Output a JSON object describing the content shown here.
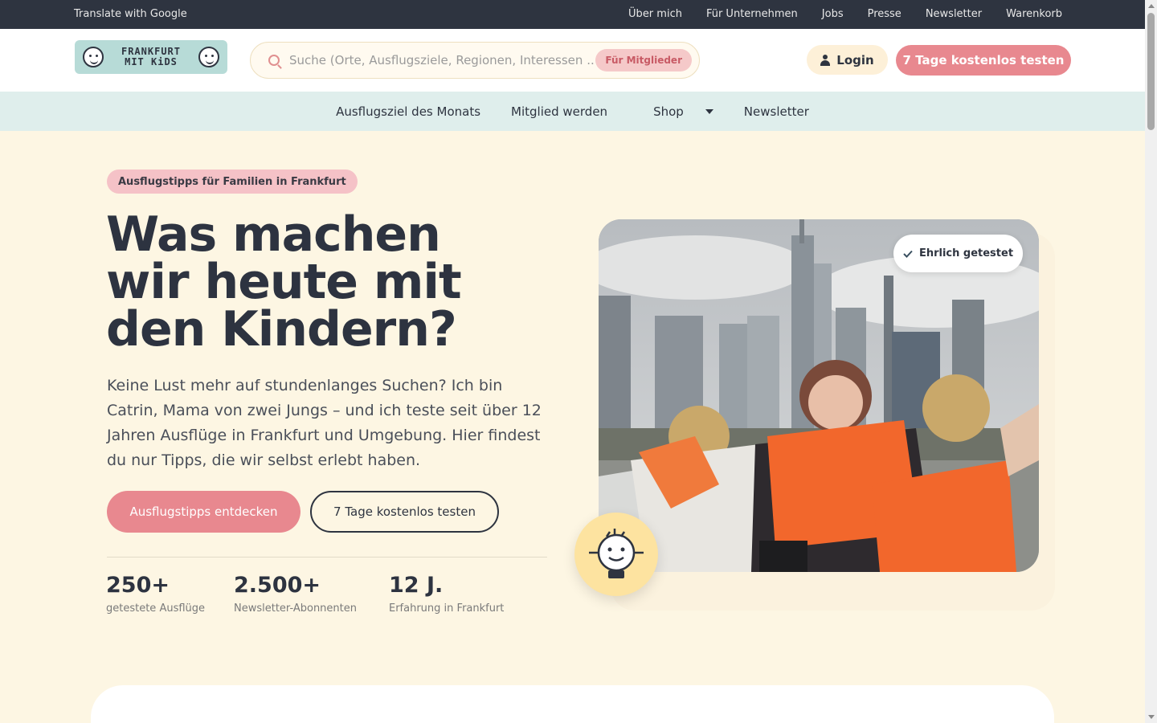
{
  "topbar": {
    "translate": "Translate with Google",
    "links": [
      "Über mich",
      "Für Unternehmen",
      "Jobs",
      "Presse",
      "Newsletter",
      "Warenkorb"
    ]
  },
  "header": {
    "logo_text_line1": "FRANKFURT",
    "logo_text_line2": "MIT KiDS",
    "search_placeholder": "Suche (Orte, Ausflugsziele, Regionen, Interessen ...",
    "member_badge": "Für Mitglieder",
    "login": "Login",
    "trial": "7 Tage kostenlos testen"
  },
  "nav": {
    "items": [
      "Ausflugsziel des Monats",
      "Mitglied werden",
      " Shop",
      "Newsletter"
    ]
  },
  "hero": {
    "tag": "Ausflugstipps für Familien in Frankfurt",
    "headline_l1": "Was machen",
    "headline_l2": "wir heute mit",
    "headline_l3": "den Kindern?",
    "intro": "Keine Lust mehr auf stundenlanges Suchen? Ich bin Catrin, Mama von zwei Jungs – und ich teste seit über 12 Jahren Ausflüge in Frankfurt und Umgebung. Hier findest du nur Tipps, die wir selbst erlebt haben.",
    "cta_primary": "Ausflugstipps entdecken",
    "cta_secondary": "7 Tage kostenlos testen",
    "stats": [
      {
        "num": "250+",
        "label": "getestete Ausflüge"
      },
      {
        "num": "2.500+",
        "label": "Newsletter-Abonnenten"
      },
      {
        "num": "12 J.",
        "label": "Erfahrung in Frankfurt"
      }
    ],
    "badge": "Ehrlich getestet"
  },
  "colors": {
    "accent": "#e8888f",
    "dark": "#2e3440",
    "cream": "#fdf6e3",
    "mint": "#dfeeec"
  }
}
